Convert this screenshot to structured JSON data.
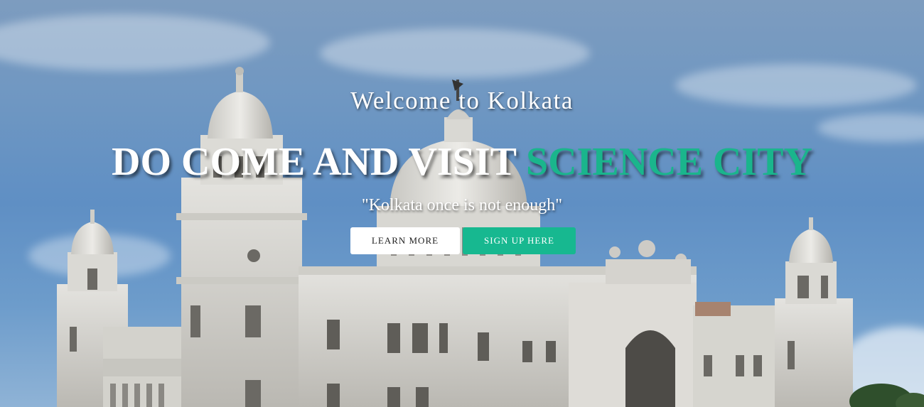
{
  "hero": {
    "welcome": "Welcome to Kolkata",
    "headline_main": "DO COME AND VISIT ",
    "headline_accent": "SCIENCE CITY",
    "quote": "\"Kolkata once is not enough\"",
    "background_image": "Victoria Memorial, Kolkata"
  },
  "buttons": {
    "learn_more": "LEARN MORE",
    "sign_up": "SIGN UP HERE"
  },
  "colors": {
    "accent": "#1ab58c",
    "button_primary": "#17b890",
    "button_secondary": "#ffffff"
  }
}
